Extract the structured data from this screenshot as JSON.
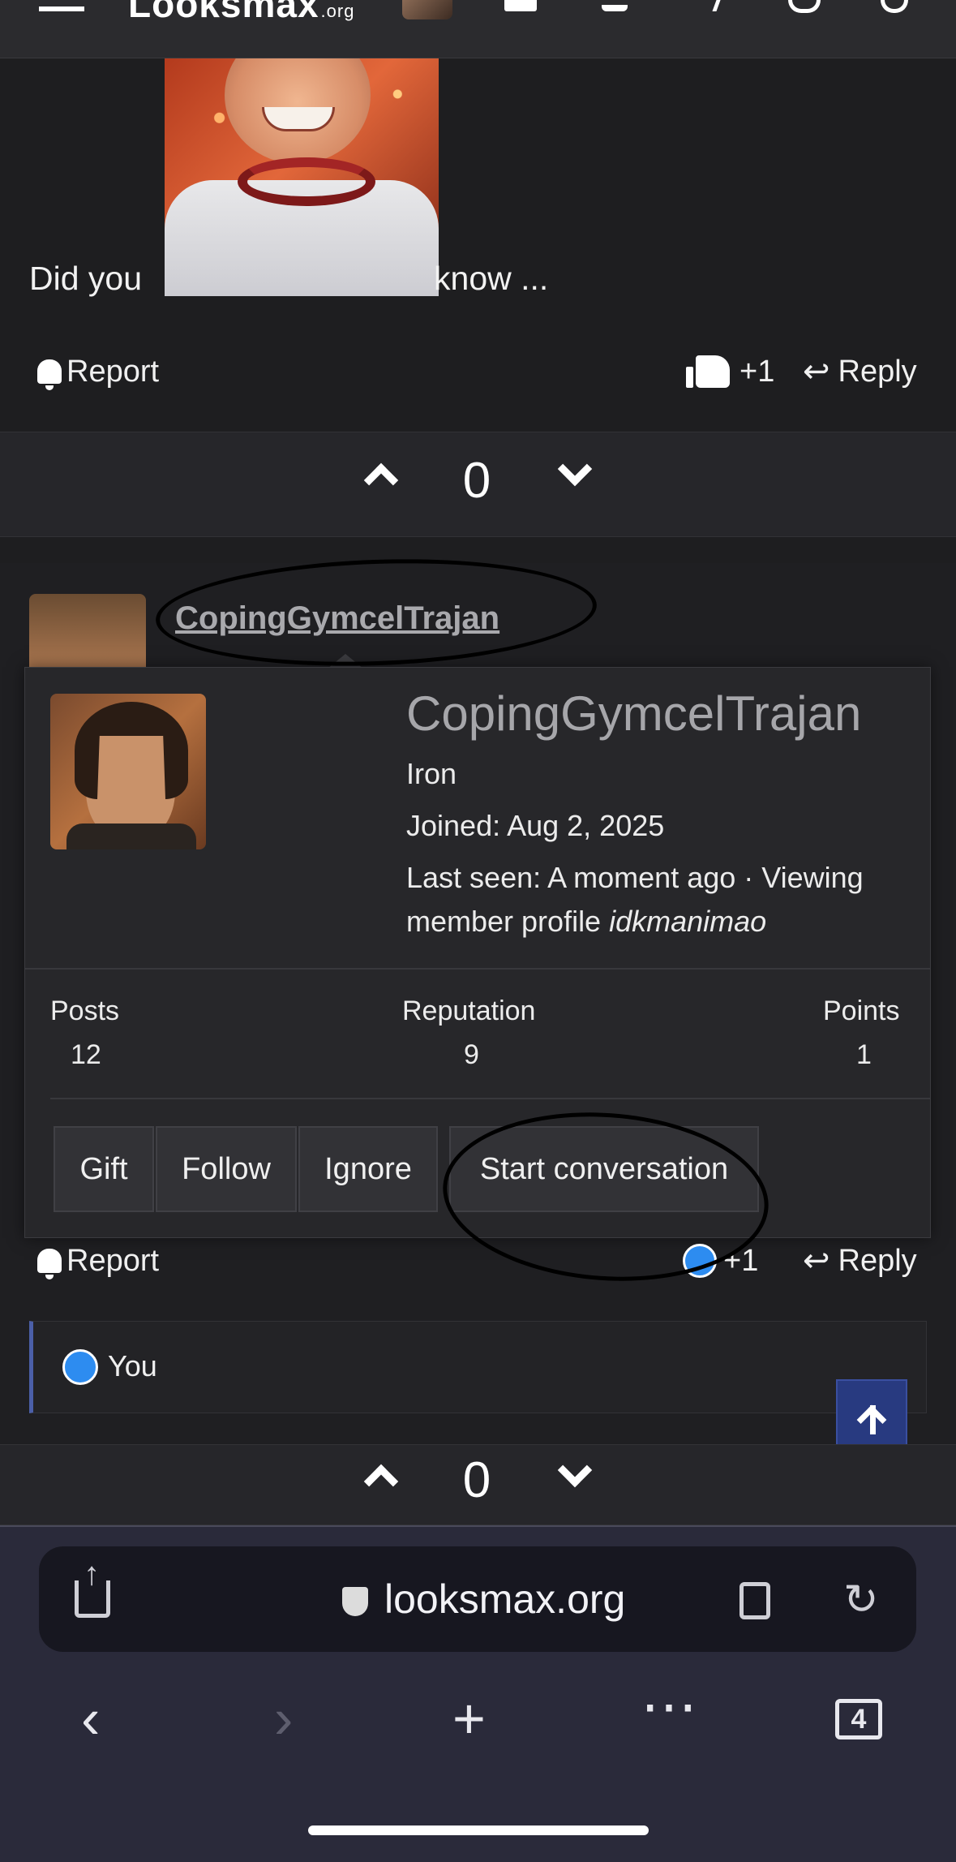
{
  "nav": {
    "logo": "Looksmax",
    "logo_tld": ".org"
  },
  "post1": {
    "text_before": "Did you",
    "text_after": "know ...",
    "report_label": "Report",
    "like_count": "+1",
    "reply_label": "Reply",
    "vote_count": "0"
  },
  "post2": {
    "username": "CopingGymcelTrajan",
    "report_label": "Report",
    "like_count": "+1",
    "reply_label": "Reply",
    "liked_by": "You",
    "vote_count": "0"
  },
  "popup": {
    "name": "CopingGymcelTrajan",
    "rank": "Iron",
    "joined": "Joined: Aug 2, 2025",
    "last_seen_line1": "Last seen: A moment ago · Viewing",
    "last_seen_line2_prefix": "member profile ",
    "last_seen_line2_target": "idkmanimao",
    "stats": [
      {
        "label": "Posts",
        "value": "12"
      },
      {
        "label": "Reputation",
        "value": "9"
      },
      {
        "label": "Points",
        "value": "1"
      }
    ],
    "buttons": [
      "Gift",
      "Follow",
      "Ignore",
      "Start conversation"
    ]
  },
  "browser": {
    "url": "looksmax.org",
    "tab_count": "4"
  },
  "colors": {
    "page_bg": "#1e1e20",
    "accent_blue": "#2d8cf0",
    "back_to_top": "#283a80"
  }
}
